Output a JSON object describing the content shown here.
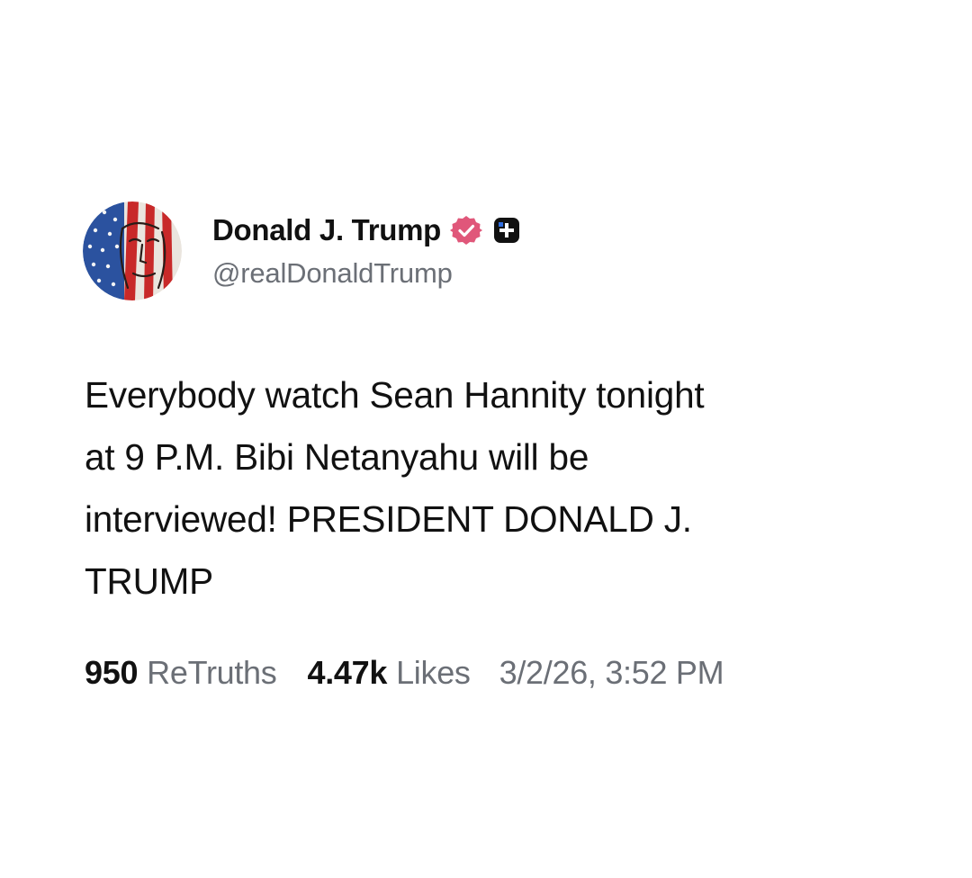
{
  "post": {
    "author": {
      "display_name": "Donald J. Trump",
      "handle": "@realDonaldTrump",
      "avatar_icon": "flag-portrait-avatar",
      "verified_icon": "verified-badge-icon",
      "badge_icon": "plus-badge-icon"
    },
    "text_lines": [
      "Everybody watch Sean Hannity tonight",
      "at 9 P.M. Bibi Netanyahu will be",
      "interviewed! PRESIDENT DONALD J.",
      "TRUMP"
    ],
    "stats": {
      "retruths_count": "950",
      "retruths_label": "ReTruths",
      "likes_count": "4.47k",
      "likes_label": "Likes"
    },
    "timestamp": "3/2/26, 3:52 PM"
  },
  "colors": {
    "background": "#ffffff",
    "text_primary": "#111111",
    "text_secondary": "#6b6f76",
    "verified_badge": "#e0577a",
    "plus_badge": "#111111"
  }
}
